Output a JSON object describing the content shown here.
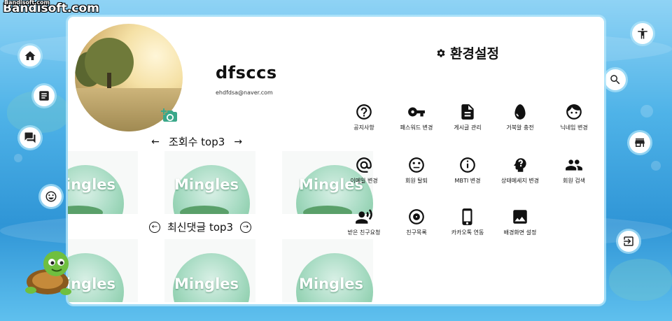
{
  "watermark": {
    "brand": "Bandisoft.com",
    "small": "Bandisoft.com"
  },
  "profile": {
    "username": "dfsccs",
    "email": "ehdfdsa@naver.com"
  },
  "views_section": {
    "title": "조회수 top3",
    "prev": "←",
    "next": "→"
  },
  "comments_section": {
    "title": "최신댓글 top3",
    "prev": "←",
    "next": "→"
  },
  "thumbnail_text": "Mingles",
  "settings": {
    "title": "환경설정",
    "items": [
      {
        "label": "공지사항",
        "icon": "help-circle-icon"
      },
      {
        "label": "패스워드 변경",
        "icon": "key-icon"
      },
      {
        "label": "게시글 관리",
        "icon": "article-icon"
      },
      {
        "label": "거북알 충전",
        "icon": "egg-icon"
      },
      {
        "label": "닉네임 변경",
        "icon": "face-icon"
      },
      {
        "label": "이메일 변경",
        "icon": "at-sign-icon"
      },
      {
        "label": "회원 탈퇴",
        "icon": "sad-face-icon"
      },
      {
        "label": "MBTI 변경",
        "icon": "info-circle-icon"
      },
      {
        "label": "상태메세지 변경",
        "icon": "psychology-icon"
      },
      {
        "label": "회원 검색",
        "icon": "group-icon"
      },
      {
        "label": "받은 친구요청",
        "icon": "record-voice-icon"
      },
      {
        "label": "친구목록",
        "icon": "disc-icon"
      },
      {
        "label": "카카오톡 연동",
        "icon": "smartphone-icon"
      },
      {
        "label": "배경화면 설정",
        "icon": "image-icon"
      }
    ]
  },
  "side_nav": {
    "left": [
      "home-icon",
      "article-icon",
      "chat-icon",
      "smile-icon"
    ],
    "right": [
      "accessibility-icon",
      "search-map-icon",
      "store-icon",
      "logout-icon"
    ]
  }
}
